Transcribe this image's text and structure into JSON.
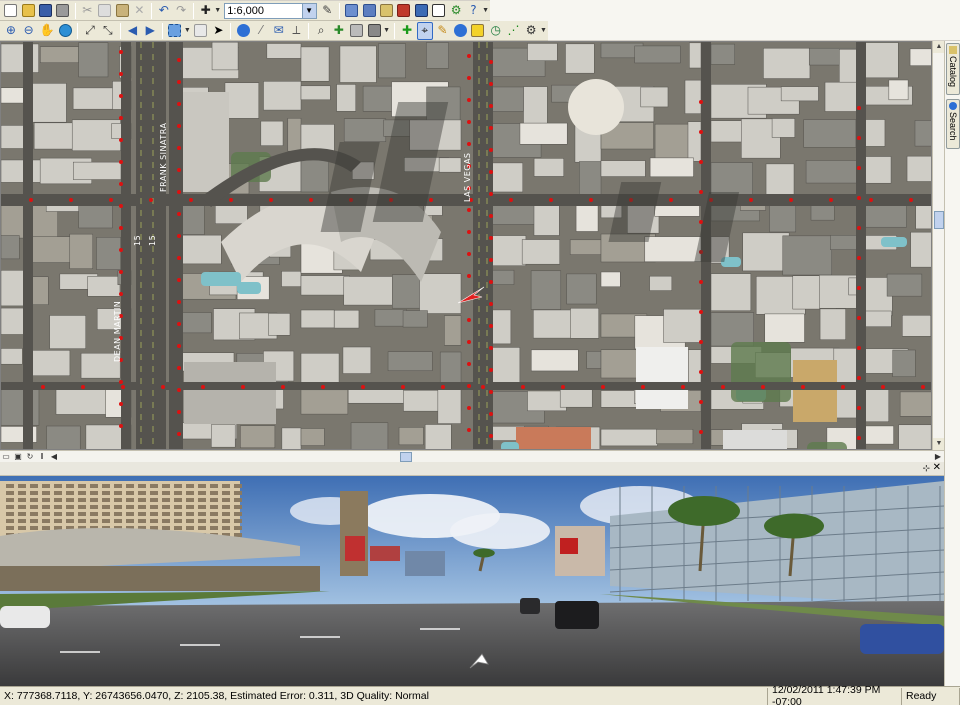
{
  "toolbar1": {
    "scale_value": "1:6,000",
    "buttons": [
      "new-icon",
      "open-icon",
      "save-icon",
      "print-icon",
      "cut-icon",
      "copy-icon",
      "paste-icon",
      "delete-icon",
      "undo-icon",
      "redo-icon",
      "add-data-icon",
      "scale-combo",
      "editor-icon",
      "table-icon",
      "toc-icon",
      "catalog-icon",
      "window-icon",
      "python-icon",
      "help-icon"
    ]
  },
  "toolbar2": {
    "buttons": [
      "zoom-in-icon",
      "zoom-out-icon",
      "pan-icon",
      "globe-icon",
      "fixed-zoom-in-icon",
      "fixed-zoom-out-icon",
      "back-icon",
      "forward-icon",
      "select-features-icon",
      "select-arrow-icon",
      "identify-icon",
      "html-popup-icon",
      "measure-icon",
      "find-icon",
      "goto-xy-icon",
      "swipe-icon",
      "viewer-icon",
      "add-point-icon",
      "target-icon",
      "pencil-icon",
      "info-icon",
      "yellow-square-icon",
      "clock-icon",
      "graph-icon",
      "settings-icon"
    ]
  },
  "map": {
    "street_labels": [
      "FRANK SINATRA",
      "LAS VEGAS",
      "DEAN MARTIN",
      "15",
      "15"
    ],
    "colors": {
      "road": "#55534e",
      "building": "#cfcdc6",
      "parking": "#8b8a83",
      "pool": "#7fc1c9",
      "marker": "#dd1111",
      "arrow": "#e02020"
    }
  },
  "side_tabs": [
    "Catalog",
    "Search"
  ],
  "status": {
    "coords": "X: 777368.7118, Y: 26743656.0470, Z: 2105.38, Estimated Error: 0.311, 3D Quality: Normal",
    "datetime": "12/02/2011 1:47:39 PM -07:00",
    "state": "Ready"
  },
  "streetview_controls": [
    "pin-icon",
    "close-icon"
  ]
}
